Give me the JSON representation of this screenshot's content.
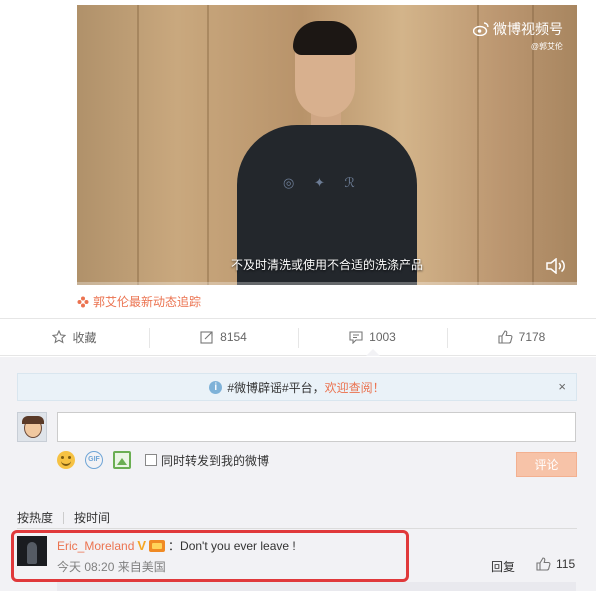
{
  "video": {
    "watermark_title": "微博视频号",
    "watermark_author": "@郭艾伦",
    "shirt_text": "◎ ✦ ℛ",
    "subtitle": "不及时清洗或使用不合适的洗涤产品",
    "volume_icon": "volume-icon"
  },
  "follow_link": {
    "icon": "weibo-flower-icon",
    "text": "郭艾伦最新动态追踪"
  },
  "actions": [
    {
      "icon": "star-icon",
      "label": "收藏"
    },
    {
      "icon": "repost-icon",
      "label": "8154"
    },
    {
      "icon": "comment-icon",
      "label": "1003"
    },
    {
      "icon": "like-icon",
      "label": "7178"
    }
  ],
  "notice": {
    "prefix": "#微博辟谣#平台，",
    "link": "欢迎查阅！",
    "close": "×"
  },
  "composer": {
    "input_placeholder": "",
    "repost_label": "同时转发到我的微博",
    "submit_label": "评论",
    "gif_label": "GIF"
  },
  "sort": {
    "hot": "按热度",
    "time": "按时间"
  },
  "comments": [
    {
      "username": "Eric_Moreland",
      "verified_badge": "V",
      "text": "：Don't you ever leave !",
      "time": "今天 08:20",
      "source": "来自美国",
      "reply_label": "回复",
      "likes": "115"
    }
  ],
  "colors": {
    "accent": "#eb7350",
    "highlight_border": "#e0393b",
    "submit_disabled": "#f7c3a8",
    "comment_bg": "#f2f2f5"
  }
}
